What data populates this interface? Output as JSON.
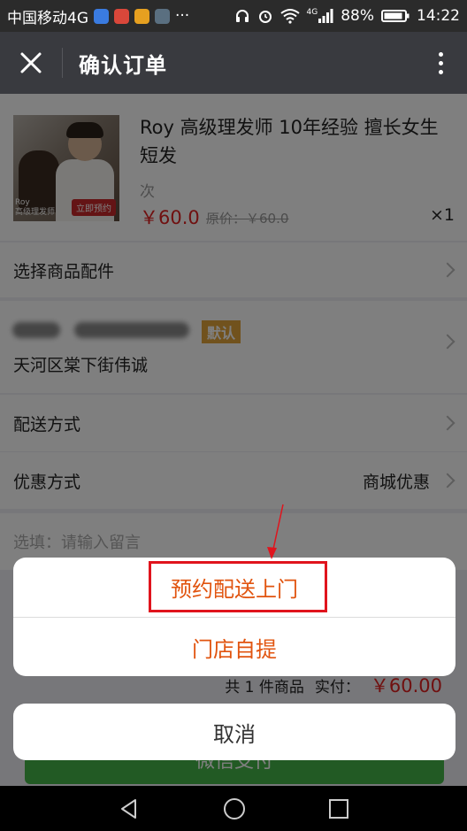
{
  "status_bar": {
    "carrier": "中国移动4G",
    "more": "···",
    "network_badge": "4G",
    "battery": "88%",
    "time": "14:22"
  },
  "header": {
    "title": "确认订单",
    "icons": [
      "close-icon",
      "more-vert-icon"
    ]
  },
  "product": {
    "title": "Roy 高级理发师 10年经验 擅长女生短发",
    "unit": "次",
    "price": "￥60.0",
    "original_price": "原价：￥60.0",
    "quantity": "×1",
    "thumb_brand": "Roy\n高级理发师",
    "thumb_badge": "立即预约"
  },
  "accessories_row": {
    "label": "选择商品配件"
  },
  "address": {
    "default_tag": "默认",
    "line": "天河区棠下街伟诚"
  },
  "delivery_row": {
    "label": "配送方式"
  },
  "discount_row": {
    "label": "优惠方式",
    "value": "商城优惠"
  },
  "note": {
    "placeholder": "选填：请输入留言"
  },
  "summary": {
    "count_text": "共 1 件商品",
    "paid_label": "实付：",
    "paid_amount": "￥60.00"
  },
  "pay_button": {
    "label": "微信支付"
  },
  "action_sheet": {
    "options": [
      "预约配送上门",
      "门店自提"
    ],
    "cancel": "取消",
    "highlight_color": "#e0141d",
    "option_color": "#e1540f"
  },
  "colors": {
    "header_bg": "#393a3f",
    "price_red": "#e02020",
    "default_tag_bg": "#e2a43a",
    "pay_green": "#44b549"
  }
}
